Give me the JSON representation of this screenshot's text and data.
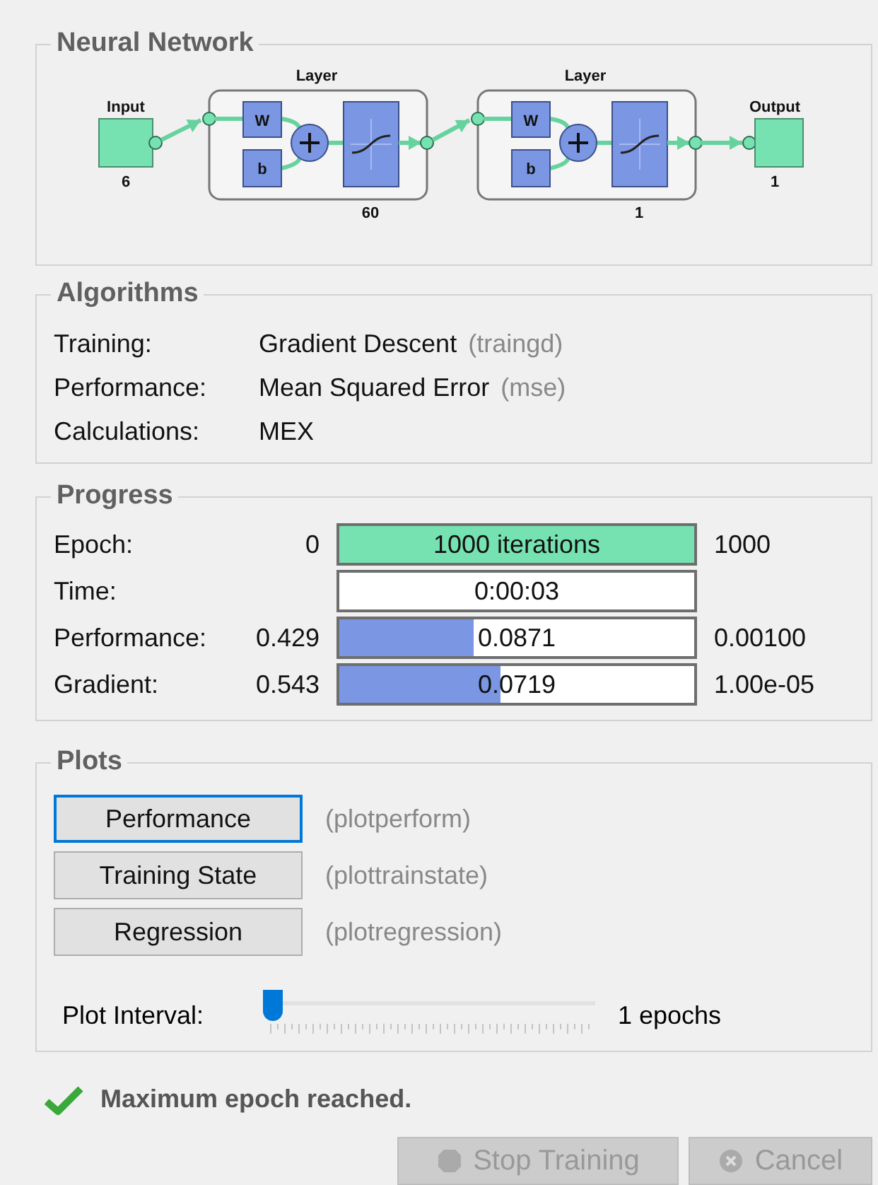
{
  "network": {
    "title": "Neural Network",
    "input": {
      "label": "Input",
      "size": "6"
    },
    "layers": [
      {
        "label": "Layer",
        "size": "60",
        "weight": "W",
        "bias": "b"
      },
      {
        "label": "Layer",
        "size": "1",
        "weight": "W",
        "bias": "b"
      }
    ],
    "output": {
      "label": "Output",
      "size": "1"
    }
  },
  "algorithms": {
    "title": "Algorithms",
    "rows": [
      {
        "label": "Training:",
        "value": "Gradient Descent",
        "hint": "(traingd)"
      },
      {
        "label": "Performance:",
        "value": "Mean Squared Error",
        "hint": "(mse)"
      },
      {
        "label": "Calculations:",
        "value": "MEX"
      }
    ]
  },
  "progress": {
    "title": "Progress",
    "rows": [
      {
        "label": "Epoch:",
        "min": "0",
        "value": "1000 iterations",
        "max": "1000",
        "level": 1,
        "color": "#77e2b1"
      },
      {
        "label": "Time:",
        "value": "0:00:03"
      },
      {
        "label": "Performance:",
        "min": "0.429",
        "value": "0.0871",
        "max": "0.00100",
        "level": 0.38,
        "color": "#7b96e2"
      },
      {
        "label": "Gradient:",
        "min": "0.543",
        "value": "0.0719",
        "max": "1.00e-05",
        "level": 0.455,
        "color": "#7b96e2"
      }
    ]
  },
  "plots": {
    "title": "Plots",
    "buttons": [
      {
        "label": "Performance",
        "hint": "(plotperform)",
        "focused": true
      },
      {
        "label": "Training State",
        "hint": "(plottrainstate)",
        "focused": false
      },
      {
        "label": "Regression",
        "hint": "(plotregression)",
        "focused": false
      }
    ],
    "interval": {
      "label": "Plot Interval:",
      "level": 0,
      "reading": "1 epochs"
    }
  },
  "status": {
    "message": "Maximum epoch reached."
  },
  "buttons": [
    {
      "label": "Stop Training",
      "kind": "stop",
      "disabled": true
    },
    {
      "label": "Cancel",
      "kind": "cancel",
      "disabled": true
    }
  ]
}
